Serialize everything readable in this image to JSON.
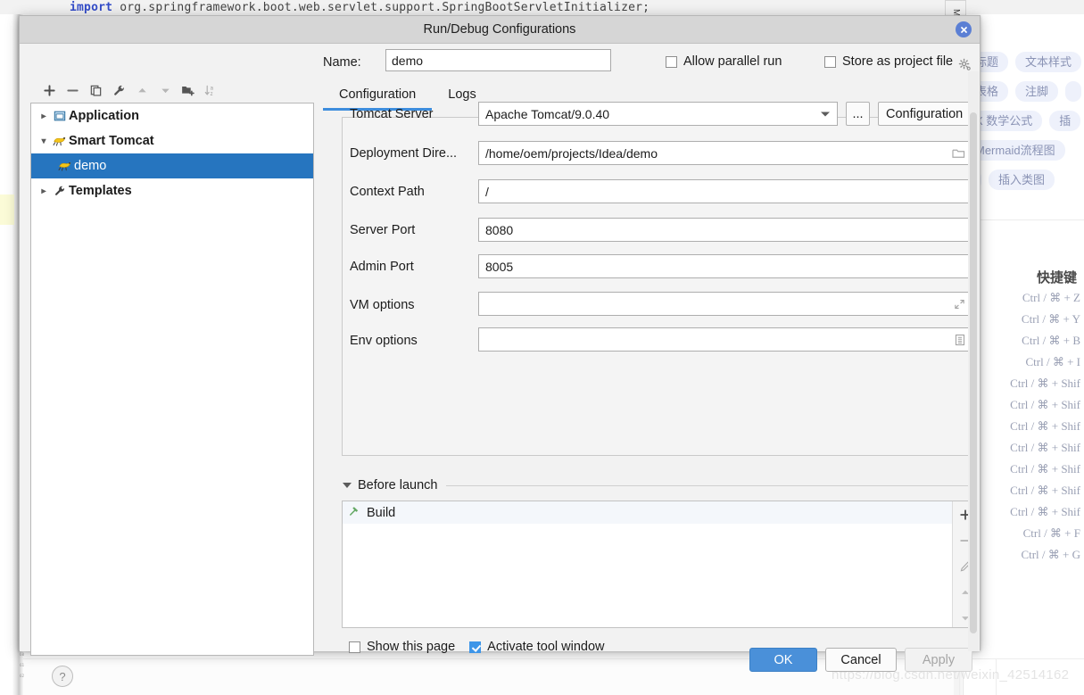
{
  "background": {
    "code_line_keyword": "import",
    "code_line_rest": " org.springframework.boot.web.servlet.support.SpringBootServletInitializer;",
    "vertical_tab_label": "Me",
    "watermark": "https://blog.csdn.net/weixin_42514162",
    "editor_tags": [
      [
        "标题",
        "文本样式"
      ],
      [
        "表格",
        "注脚",
        ""
      ],
      [
        "X 数学公式",
        "插"
      ],
      [
        "Mermaid流程图"
      ],
      [
        "",
        "插入类图"
      ]
    ],
    "shortcuts_title": "快捷键",
    "shortcuts": [
      "Ctrl / ⌘ + Z",
      "Ctrl / ⌘ + Y",
      "Ctrl / ⌘ + B",
      "Ctrl / ⌘ + I",
      "Ctrl / ⌘ + Shif",
      "Ctrl / ⌘ + Shif",
      "Ctrl / ⌘ + Shif",
      "Ctrl / ⌘ + Shif",
      "Ctrl / ⌘ + Shif",
      "Ctrl / ⌘ + Shif",
      "Ctrl / ⌘ + Shif",
      "Ctrl / ⌘ + F",
      "Ctrl / ⌘ + G"
    ]
  },
  "dialog": {
    "title": "Run/Debug Configurations",
    "close_icon": "close-icon",
    "header": {
      "name_label": "Name:",
      "name_value": "demo",
      "allow_parallel_run": {
        "label": "Allow parallel run",
        "checked": false
      },
      "store_as_project_file": {
        "label": "Store as project file",
        "checked": false
      },
      "gear_icon": "gear-icon"
    },
    "tabs": [
      {
        "label": "Configuration",
        "active": true
      },
      {
        "label": "Logs",
        "active": false
      }
    ],
    "tree_toolbar": [
      "plus-icon",
      "minus-icon",
      "copy-icon",
      "wrench-icon",
      "arrow-up-icon",
      "arrow-down-icon",
      "folder-add-icon",
      "sort-az-icon"
    ],
    "tree": [
      {
        "label": "Application",
        "icon": "application-icon",
        "expander": "chevron-right-icon",
        "depth": 0,
        "selected": false,
        "bold": true
      },
      {
        "label": "Smart Tomcat",
        "icon": "tomcat-icon",
        "expander": "chevron-down-icon",
        "depth": 0,
        "selected": false,
        "bold": true
      },
      {
        "label": "demo",
        "icon": "tomcat-icon",
        "expander": "",
        "depth": 1,
        "selected": true,
        "bold": false
      },
      {
        "label": "Templates",
        "icon": "wrench-icon",
        "expander": "chevron-right-icon",
        "depth": 0,
        "selected": false,
        "bold": true
      }
    ],
    "help_button": "?",
    "form": {
      "tomcat_server": {
        "label": "Tomcat Server",
        "value": "Apache Tomcat/9.0.40",
        "browse_button": "...",
        "configuration_button": "Configuration"
      },
      "deployment_directory": {
        "label": "Deployment Dire...",
        "value": "/home/oem/projects/Idea/demo",
        "icon": "folder-icon"
      },
      "context_path": {
        "label": "Context Path",
        "value": "/"
      },
      "server_port": {
        "label": "Server Port",
        "value": "8080"
      },
      "admin_port": {
        "label": "Admin Port",
        "value": "8005"
      },
      "vm_options": {
        "label": "VM options",
        "value": "",
        "icon": "expand-icon"
      },
      "env_options": {
        "label": "Env options",
        "value": "",
        "icon": "list-icon"
      }
    },
    "before_launch": {
      "title": "Before launch",
      "caret": "caret-down-icon",
      "items": [
        {
          "label": "Build",
          "icon": "hammer-icon"
        }
      ],
      "side_buttons": [
        "add-icon",
        "remove-icon",
        "edit-icon",
        "move-up-icon",
        "move-down-icon"
      ]
    },
    "footer": {
      "show_this_page": {
        "label": "Show this page",
        "checked": false
      },
      "activate_tool_window": {
        "label": "Activate tool window",
        "checked": true
      },
      "ok_button": "OK",
      "cancel_button": "Cancel",
      "apply_button": "Apply"
    }
  },
  "colors": {
    "accent": "#4a90d9",
    "selection": "#2675bf",
    "tab_underline": "#3d8ddd",
    "close_button": "#5b7fd4",
    "dialog_bg": "#f2f2f2",
    "titlebar_bg": "#d6d6d6"
  }
}
